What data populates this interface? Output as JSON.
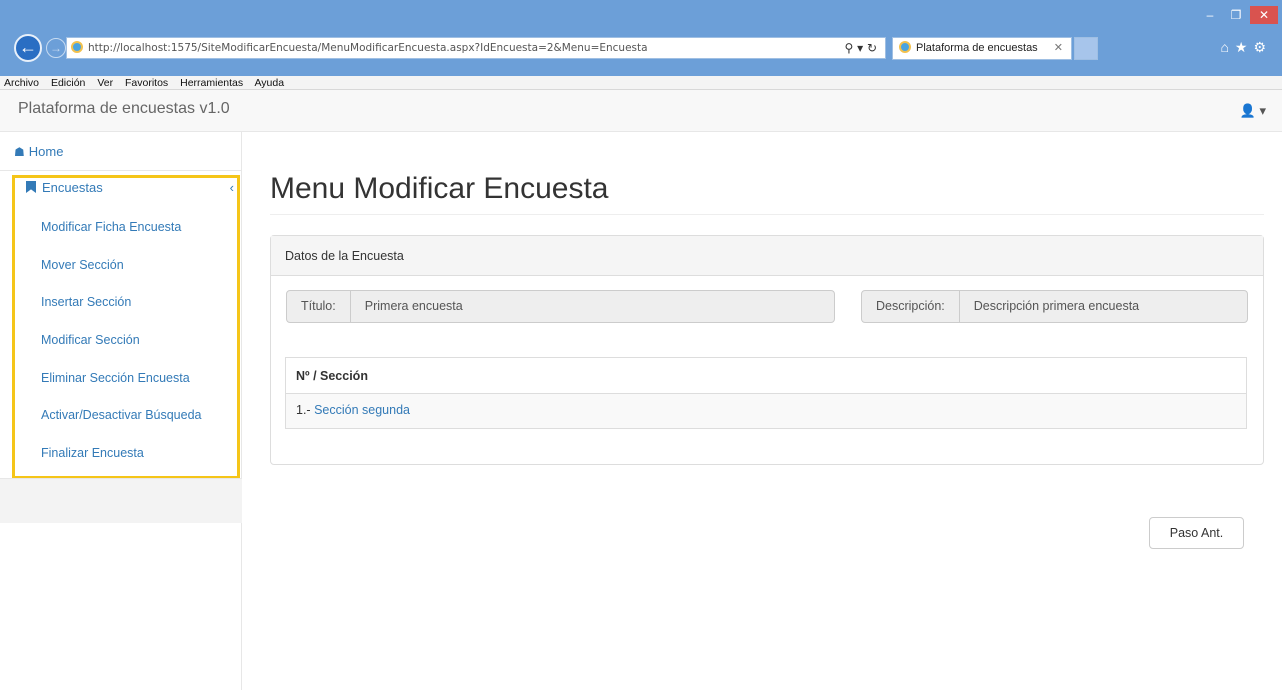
{
  "browser": {
    "url": "http://localhost:1575/SiteModificarEncuesta/MenuModificarEncuesta.aspx?IdEncuesta=2&Menu=Encuesta",
    "tab_title": "Plataforma de encuestas",
    "menu": [
      "Archivo",
      "Edición",
      "Ver",
      "Favoritos",
      "Herramientas",
      "Ayuda"
    ]
  },
  "app": {
    "brand": "Plataforma de encuestas v1.0"
  },
  "sidebar": {
    "home": "Home",
    "section": "Encuestas",
    "items": [
      "Modificar Ficha Encuesta",
      "Mover Sección",
      "Insertar Sección",
      "Modificar Sección",
      "Eliminar Sección Encuesta",
      "Activar/Desactivar Búsqueda",
      "Finalizar Encuesta"
    ]
  },
  "main": {
    "title": "Menu Modificar Encuesta",
    "panel_title": "Datos de la Encuesta",
    "titulo_label": "Título:",
    "titulo_value": "Primera encuesta",
    "descripcion_label": "Descripción:",
    "descripcion_value": "Descripción primera encuesta",
    "table_header": "Nº / Sección",
    "rows": [
      {
        "num": "1.- ",
        "name": "Sección segunda"
      }
    ],
    "prev_button": "Paso Ant."
  },
  "colors": {
    "highlight": "#f5c518",
    "link": "#337ab7",
    "chrome": "#6c9fd8"
  }
}
